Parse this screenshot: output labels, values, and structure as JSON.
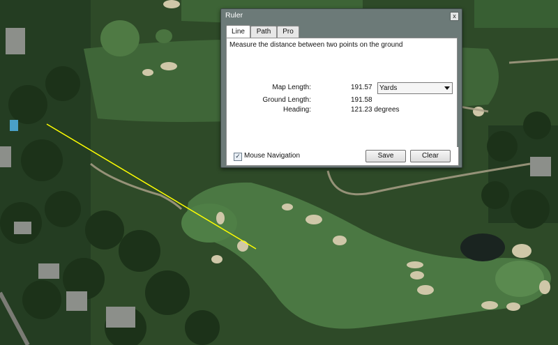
{
  "dialog": {
    "title": "Ruler",
    "close_glyph": "x",
    "tabs": [
      {
        "label": "Line",
        "active": true
      },
      {
        "label": "Path",
        "active": false
      },
      {
        "label": "Pro",
        "active": false
      }
    ],
    "description": "Measure the distance between two points on the ground",
    "map_length_label": "Map Length:",
    "map_length_value": "191.57",
    "unit_selected": "Yards",
    "ground_length_label": "Ground Length:",
    "ground_length_value": "191.58",
    "heading_label": "Heading:",
    "heading_value": "121.23 degrees",
    "mouse_navigation_label": "Mouse Navigation",
    "mouse_navigation_checked": true,
    "checkbox_glyph": "✓",
    "save_label": "Save",
    "clear_label": "Clear"
  },
  "colors": {
    "ruler_line": "#ffff00",
    "dialog_frame": "#6c7a78"
  },
  "icons": {
    "close": "close-icon",
    "dropdown": "chevron-down-icon",
    "checkbox": "checkmark-icon"
  }
}
